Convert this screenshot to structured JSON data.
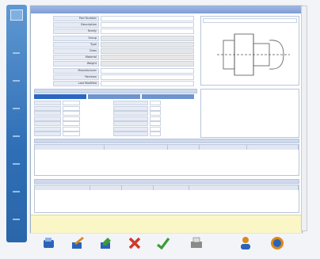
{
  "window": {
    "title": ""
  },
  "form": {
    "labels": [
      "Part Number",
      "Description",
      "Family",
      "Group",
      "Type",
      "Class",
      "Material",
      "Weight",
      "Manufacturer",
      "Revision",
      "Last Modified"
    ],
    "values": [
      "",
      "",
      "",
      "",
      "",
      "",
      "",
      "",
      "",
      "",
      ""
    ]
  },
  "drawing": {
    "label": ""
  },
  "dims": {
    "header": "",
    "tabs": [
      "",
      "",
      ""
    ],
    "rows": [
      "",
      "",
      "",
      "",
      "",
      "",
      ""
    ]
  },
  "grid1": {
    "title": "",
    "columns": [
      "",
      "",
      "",
      "",
      ""
    ]
  },
  "grid2": {
    "title": "",
    "columns": [
      "",
      "",
      "",
      "",
      ""
    ]
  },
  "note": {
    "text": ""
  },
  "toolbar": {
    "icons": [
      "open-icon",
      "edit-icon",
      "new-icon",
      "delete-icon",
      "save-icon",
      "print-icon",
      "user-icon",
      "help-icon"
    ],
    "colors": {
      "blue": "#2b63b8",
      "green": "#3c9a3a",
      "red": "#cf3a2a",
      "orange": "#d98a1b"
    }
  }
}
